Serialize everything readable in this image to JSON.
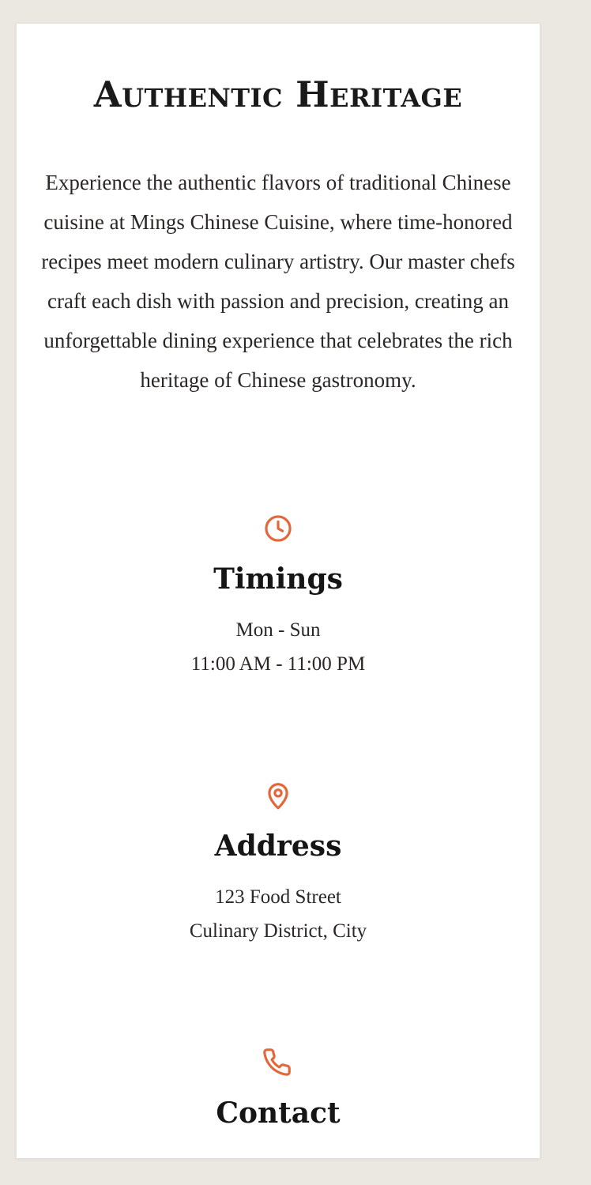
{
  "heading": "Authentic Heritage",
  "intro": "Experience the authentic flavors of traditional Chinese cuisine at Mings Chinese Cuisine, where time-honored recipes meet modern culinary artistry. Our master chefs craft each dish with passion and precision, creating an unforgettable dining experience that celebrates the rich heritage of Chinese gastronomy.",
  "accent_color": "#e2673a",
  "info": {
    "timings": {
      "icon": "clock-icon",
      "title": "Timings",
      "lines": [
        "Mon - Sun",
        "11:00 AM - 11:00 PM"
      ]
    },
    "address": {
      "icon": "map-pin-icon",
      "title": "Address",
      "lines": [
        "123 Food Street",
        "Culinary District, City"
      ]
    },
    "contact": {
      "icon": "phone-icon",
      "title": "Contact"
    }
  }
}
